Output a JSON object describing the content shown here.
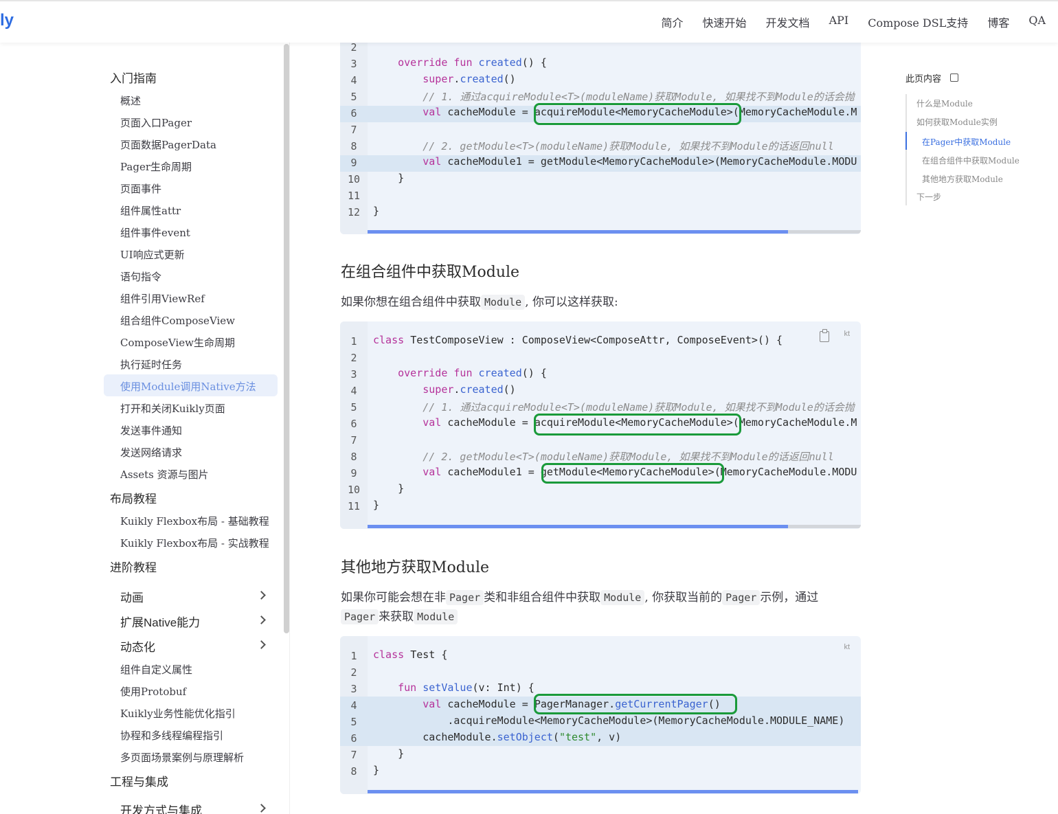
{
  "nav": {
    "logo": "ly",
    "links": [
      "简介",
      "快速开始",
      "开发文档",
      "API",
      "Compose DSL支持",
      "博客",
      "QA"
    ]
  },
  "sidebar": {
    "groups": {
      "intro": "入门指南",
      "layout": "布局教程",
      "advanced": "进阶教程",
      "engineering": "工程与集成"
    },
    "intro_items": [
      "概述",
      "页面入口Pager",
      "页面数据PagerData",
      "Pager生命周期",
      "页面事件",
      "组件属性attr",
      "组件事件event",
      "UI响应式更新",
      "语句指令",
      "组件引用ViewRef",
      "组合组件ComposeView",
      "ComposeView生命周期",
      "执行延时任务",
      "使用Module调用Native方法",
      "打开和关闭Kuikly页面",
      "发送事件通知",
      "发送网络请求",
      "Assets 资源与图片"
    ],
    "active_item": "使用Module调用Native方法",
    "layout_items": [
      "Kuikly Flexbox布局 - 基础教程",
      "Kuikly Flexbox布局 - 实战教程"
    ],
    "advanced_expandable": [
      "动画",
      "扩展Native能力",
      "动态化"
    ],
    "advanced_items": [
      "组件自定义属性",
      "使用Protobuf",
      "Kuikly业务性能优化指引",
      "协程和多线程编程指引",
      "多页面场景案例与原理解析"
    ],
    "engineering_expandable": [
      "开发方式与集成"
    ]
  },
  "main": {
    "section2_title": "在组合组件中获取Module",
    "section2_para_pre": "如果你想在组合组件中获取",
    "section2_para_code": "Module",
    "section2_para_post": ", 你可以这样获取:",
    "section3_title": "其他地方获取Module",
    "section3_para_1": "如果你可能会想在非",
    "section3_para_code1": "Pager",
    "section3_para_2": "类和非组合组件中获取",
    "section3_para_code2": "Module",
    "section3_para_3": ", 你获取当前的",
    "section3_para_code3": "Pager",
    "section3_para_4": "示例，通过",
    "section3_para_code4": "Pager",
    "section3_para_5": "来获取",
    "section3_para_code5": "Module",
    "lang_label": "kt"
  },
  "outline": {
    "title": "此页内容",
    "items": [
      "什么是Module",
      "如何获取Module实例",
      "在Pager中获取Module",
      "在组合组件中获取Module",
      "其他地方获取Module",
      "下一步"
    ],
    "active": "在Pager中获取Module"
  },
  "code": {
    "block1": {
      "line_numbers": [
        "2",
        "3",
        "4",
        "5",
        "6",
        "7",
        "8",
        "9",
        "10",
        "11",
        "12"
      ]
    },
    "block2": {
      "line_numbers": [
        "1",
        "2",
        "3",
        "4",
        "5",
        "6",
        "7",
        "8",
        "9",
        "10",
        "11"
      ]
    },
    "block3": {
      "line_numbers": [
        "1",
        "2",
        "3",
        "4",
        "5",
        "6",
        "7",
        "8"
      ]
    },
    "tokens": {
      "override": "override",
      "fun": "fun",
      "created": "created",
      "super": "super",
      "val": "val",
      "class": "class",
      "comment1": "// 1. 通过acquireModule<T>(moduleName)获取Module, 如果找不到Module的话会抛",
      "comment2": "// 2. getModule<T>(moduleName)获取Module, 如果找不到Module的话返回null",
      "cacheModule": "cacheModule",
      "cacheModule1": "cacheModule1",
      "acquire": "acquireModule<MemoryCacheModule>",
      "acquire_tail": "(MemoryCacheModule.M",
      "get": "getModule<MemoryCacheModule>",
      "get_tail": "(MemoryCacheModule.MODU",
      "testCompose": "TestComposeView",
      "composeSig": "ComposeView<ComposeAttr, ComposeEvent>() {",
      "test": "Test {",
      "setValue": "setValue",
      "setValueArgs": "(v: Int) {",
      "pagerManager": "PagerManager.",
      "getCurrentPager": "getCurrentPager",
      "acquireChain": ".acquireModule<MemoryCacheModule>(MemoryCacheModule.MODULE_NAME)",
      "setObject": "setObject",
      "testStr": "\"test\"",
      "setObjectTail": ", v)",
      "brace_open": "() {",
      "paren": "()",
      "brace_close": "}"
    }
  }
}
